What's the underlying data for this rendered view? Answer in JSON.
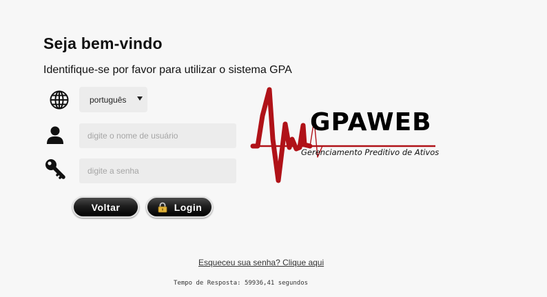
{
  "header": {
    "title": "Seja bem-vindo",
    "subtitle": "Identifique-se por favor para utilizar o sistema GPA"
  },
  "form": {
    "language": {
      "icon": "globe-icon",
      "selected": "português"
    },
    "username": {
      "icon": "user-icon",
      "value": "",
      "placeholder": "digite o nome de usuário"
    },
    "password": {
      "icon": "key-icon",
      "value": "",
      "placeholder": "digite a senha"
    },
    "buttons": {
      "back_label": "Voltar",
      "login_label": "Login",
      "login_icon": "lock-icon"
    }
  },
  "logo": {
    "name": "GPAWEB",
    "tagline": "Gerenciamento Preditivo de Ativos",
    "accent_color": "#b01218"
  },
  "footer": {
    "forgot_link": "Esqueceu sua senha? Clique aqui",
    "response_time": "Tempo de Resposta: 59936,41 segundos"
  }
}
